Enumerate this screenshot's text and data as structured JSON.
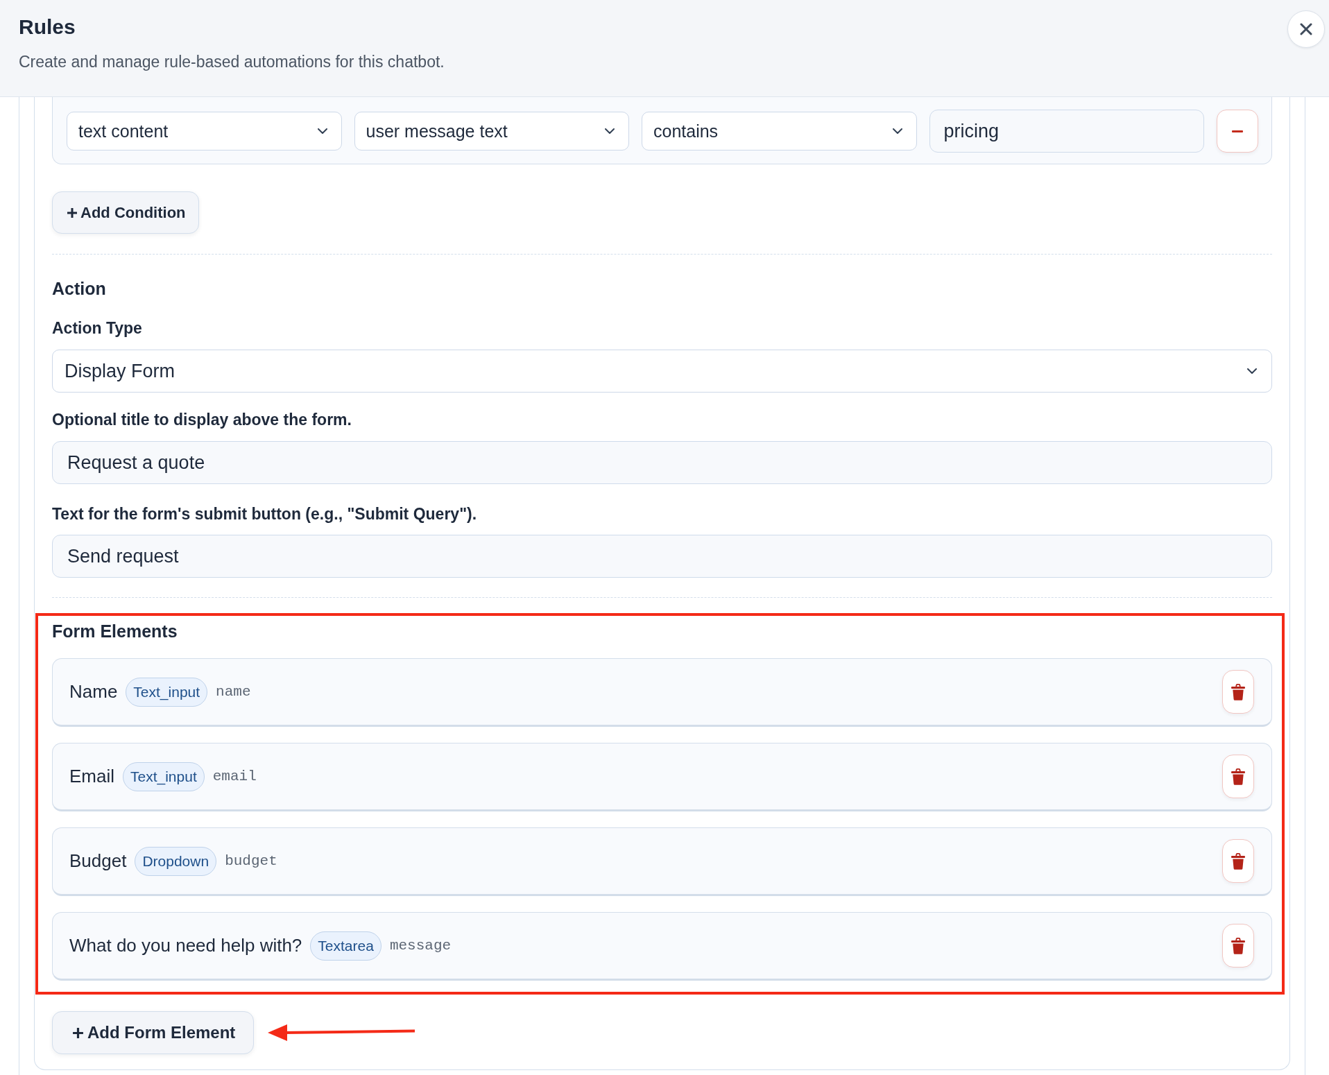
{
  "header": {
    "title": "Rules",
    "subtitle": "Create and manage rule-based automations for this chatbot."
  },
  "conditions": [
    {
      "field": "text content",
      "source": "user message text",
      "operator": "contains",
      "value": "pricing"
    }
  ],
  "add_condition_button": {
    "label": "Add Condition"
  },
  "action": {
    "heading": "Action",
    "type_label": "Action Type",
    "type_value": "Display Form",
    "title_label": "Optional title to display above the form.",
    "title_value": "Request a quote",
    "submit_label": "Text for the form's submit button (e.g., \"Submit Query\").",
    "submit_value": "Send request"
  },
  "form_elements": {
    "heading": "Form Elements",
    "highlighted": true,
    "items": [
      {
        "label": "Name",
        "type": "Text_input",
        "key": "name"
      },
      {
        "label": "Email",
        "type": "Text_input",
        "key": "email"
      },
      {
        "label": "Budget",
        "type": "Dropdown",
        "key": "budget"
      },
      {
        "label": "What do you need help with?",
        "type": "Textarea",
        "key": "message"
      }
    ],
    "add_button": {
      "label": "Add Form Element",
      "pointed_at": true
    }
  }
}
